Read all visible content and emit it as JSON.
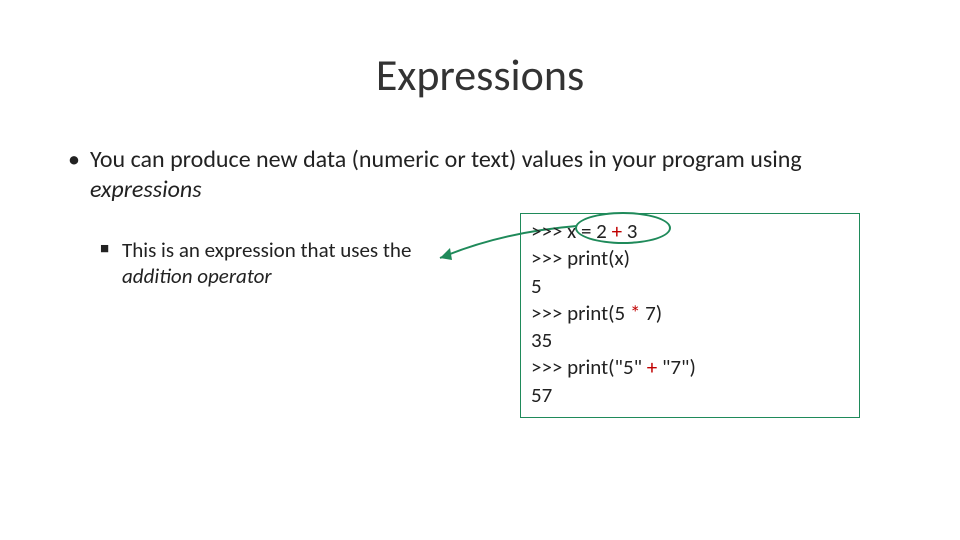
{
  "title": "Expressions",
  "bullet1": {
    "pre": "You can produce new data (numeric or text) values in your program using ",
    "em": "expressions"
  },
  "bullet2": {
    "pre": "This is an expression that uses the ",
    "em": "addition operator"
  },
  "code": {
    "l1a": ">>> x = 2 ",
    "l1op": "+",
    "l1b": " 3",
    "l2": ">>> print(x)",
    "l3": "5",
    "l4a": ">>> print(5 ",
    "l4op": "*",
    "l4b": " 7)",
    "l5": "35",
    "l6a": ">>> print(\"5\" ",
    "l6op": "+",
    "l6b": " \"7\")",
    "l7": "57"
  },
  "accent": "#1f8a5a"
}
